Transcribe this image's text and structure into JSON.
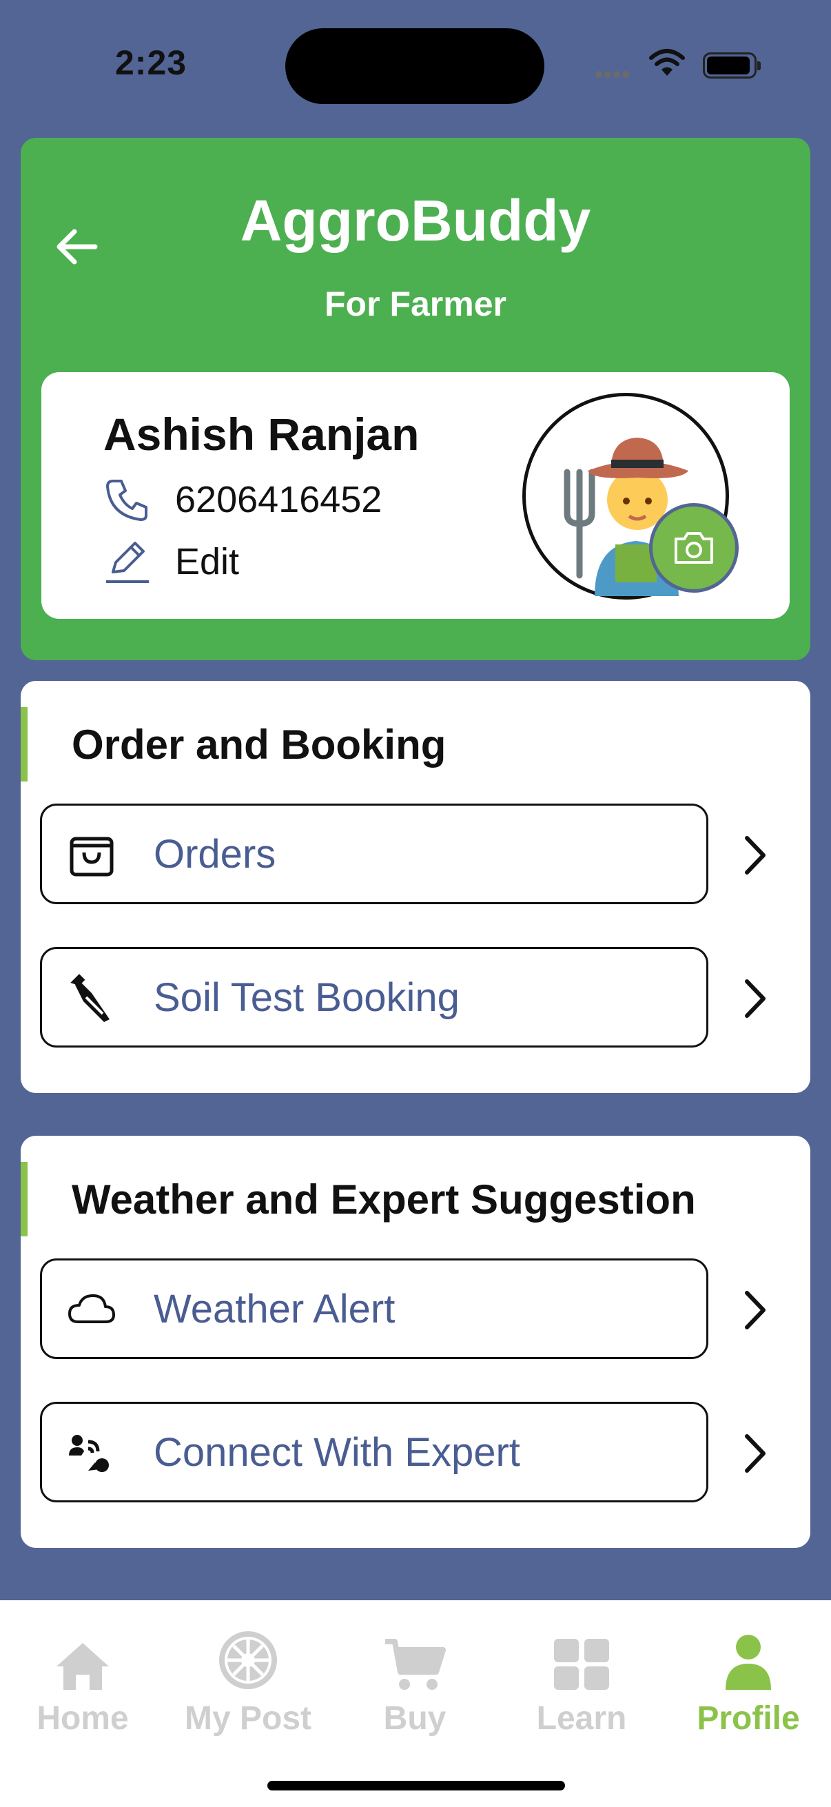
{
  "status_bar": {
    "time": "2:23"
  },
  "header": {
    "title": "AggroBuddy",
    "subtitle": "For Farmer"
  },
  "profile": {
    "name": "Ashish Ranjan",
    "phone": "6206416452",
    "edit_label": "Edit"
  },
  "sections": [
    {
      "title": "Order and Booking",
      "items": [
        {
          "label": "Orders",
          "icon": "shopping-bag-icon"
        },
        {
          "label": "Soil Test Booking",
          "icon": "dropper-icon"
        }
      ]
    },
    {
      "title": "Weather and Expert Suggestion",
      "items": [
        {
          "label": "Weather Alert",
          "icon": "cloud-icon"
        },
        {
          "label": "Connect With Expert",
          "icon": "expert-call-icon"
        }
      ]
    }
  ],
  "tabs": [
    {
      "label": "Home",
      "icon": "home-icon",
      "active": false
    },
    {
      "label": "My Post",
      "icon": "emblem-icon",
      "active": false
    },
    {
      "label": "Buy",
      "icon": "cart-icon",
      "active": false
    },
    {
      "label": "Learn",
      "icon": "grid-icon",
      "active": false
    },
    {
      "label": "Profile",
      "icon": "user-icon",
      "active": true
    }
  ],
  "colors": {
    "background": "#536594",
    "header_green": "#4caf50",
    "accent_green": "#8bc34a",
    "menu_text": "#4a5d92",
    "tab_inactive": "#cfcfcf"
  }
}
